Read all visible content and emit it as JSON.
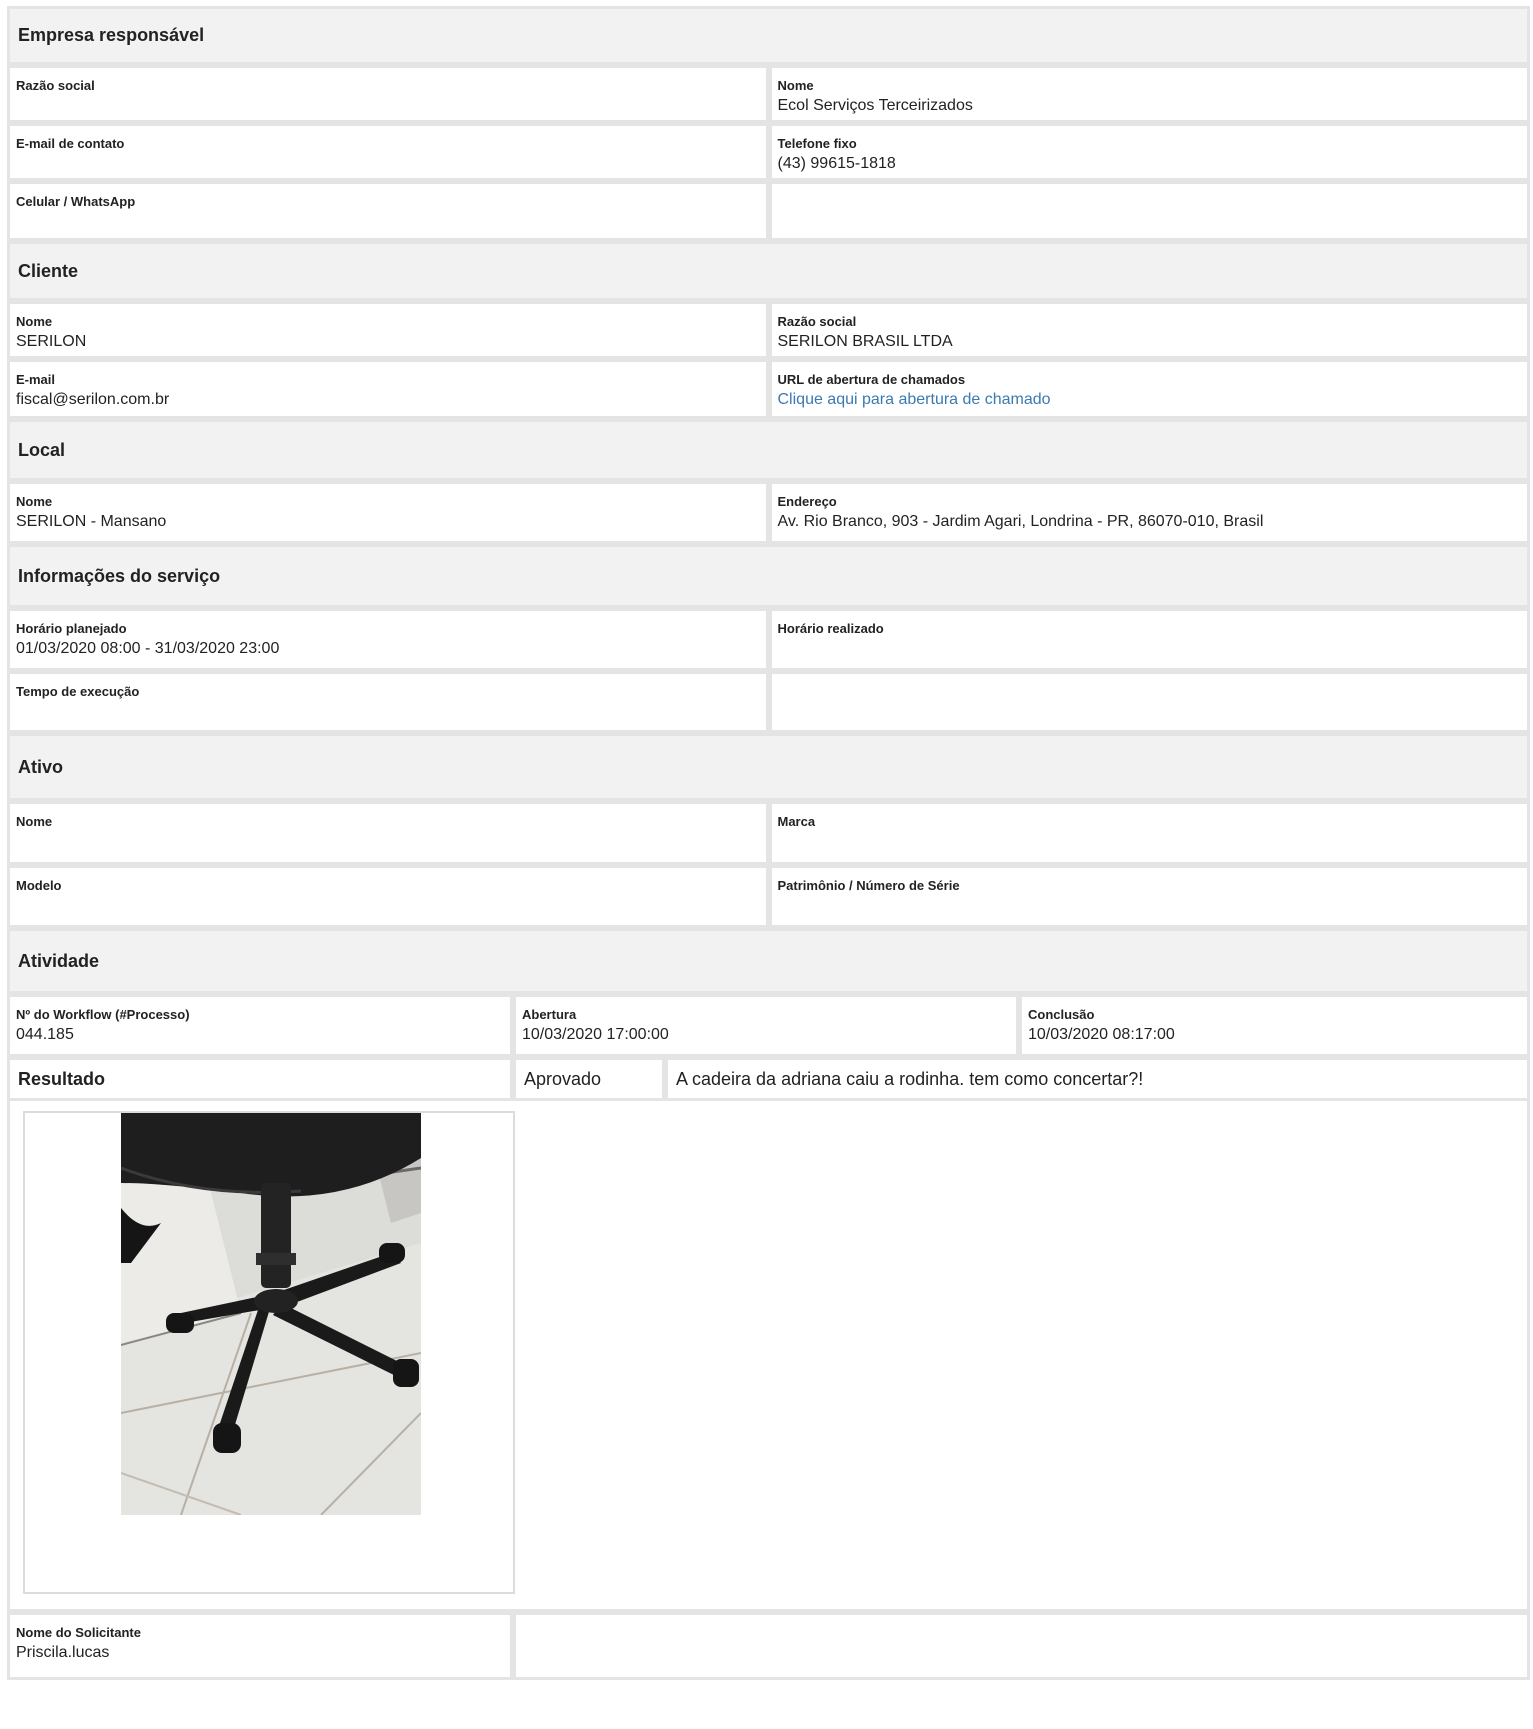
{
  "sections": {
    "empresa": {
      "title": "Empresa responsável",
      "razao_social_label": "Razão social",
      "razao_social_value": "",
      "nome_label": "Nome",
      "nome_value": "Ecol Serviços Terceirizados",
      "email_label": "E-mail de contato",
      "email_value": "",
      "telefone_label": "Telefone fixo",
      "telefone_value": "(43) 99615-1818",
      "celular_label": "Celular / WhatsApp",
      "celular_value": ""
    },
    "cliente": {
      "title": "Cliente",
      "nome_label": "Nome",
      "nome_value": "SERILON",
      "razao_social_label": "Razão social",
      "razao_social_value": "SERILON BRASIL LTDA",
      "email_label": "E-mail",
      "email_value": "fiscal@serilon.com.br",
      "url_label": "URL de abertura de chamados",
      "url_value": "Clique aqui para abertura de chamado"
    },
    "local": {
      "title": "Local",
      "nome_label": "Nome",
      "nome_value": "SERILON - Mansano",
      "endereco_label": "Endereço",
      "endereco_value": "Av. Rio Branco, 903 - Jardim Agari, Londrina - PR, 86070-010, Brasil"
    },
    "servico": {
      "title": "Informações do serviço",
      "planejado_label": "Horário planejado",
      "planejado_value": "01/03/2020 08:00 - 31/03/2020 23:00",
      "realizado_label": "Horário realizado",
      "realizado_value": "",
      "tempo_label": "Tempo de execução",
      "tempo_value": ""
    },
    "ativo": {
      "title": "Ativo",
      "nome_label": "Nome",
      "marca_label": "Marca",
      "modelo_label": "Modelo",
      "patrimonio_label": "Patrimônio / Número de Série"
    },
    "atividade": {
      "title": "Atividade",
      "workflow_label": "Nº do Workflow (#Processo)",
      "workflow_value": "044.185",
      "abertura_label": "Abertura",
      "abertura_value": "10/03/2020 17:00:00",
      "conclusao_label": "Conclusão",
      "conclusao_value": "10/03/2020 08:17:00",
      "resultado_label": "Resultado",
      "resultado_status": "Aprovado",
      "resultado_desc": "A cadeira da adriana caiu a rodinha. tem como concertar?!",
      "solicitante_label": "Nome do Solicitante",
      "solicitante_value": "Priscila.lucas"
    }
  },
  "colors": {
    "link": "#3a7ab3",
    "section_bg": "#f2f2f2",
    "border": "#e4e4e4"
  }
}
